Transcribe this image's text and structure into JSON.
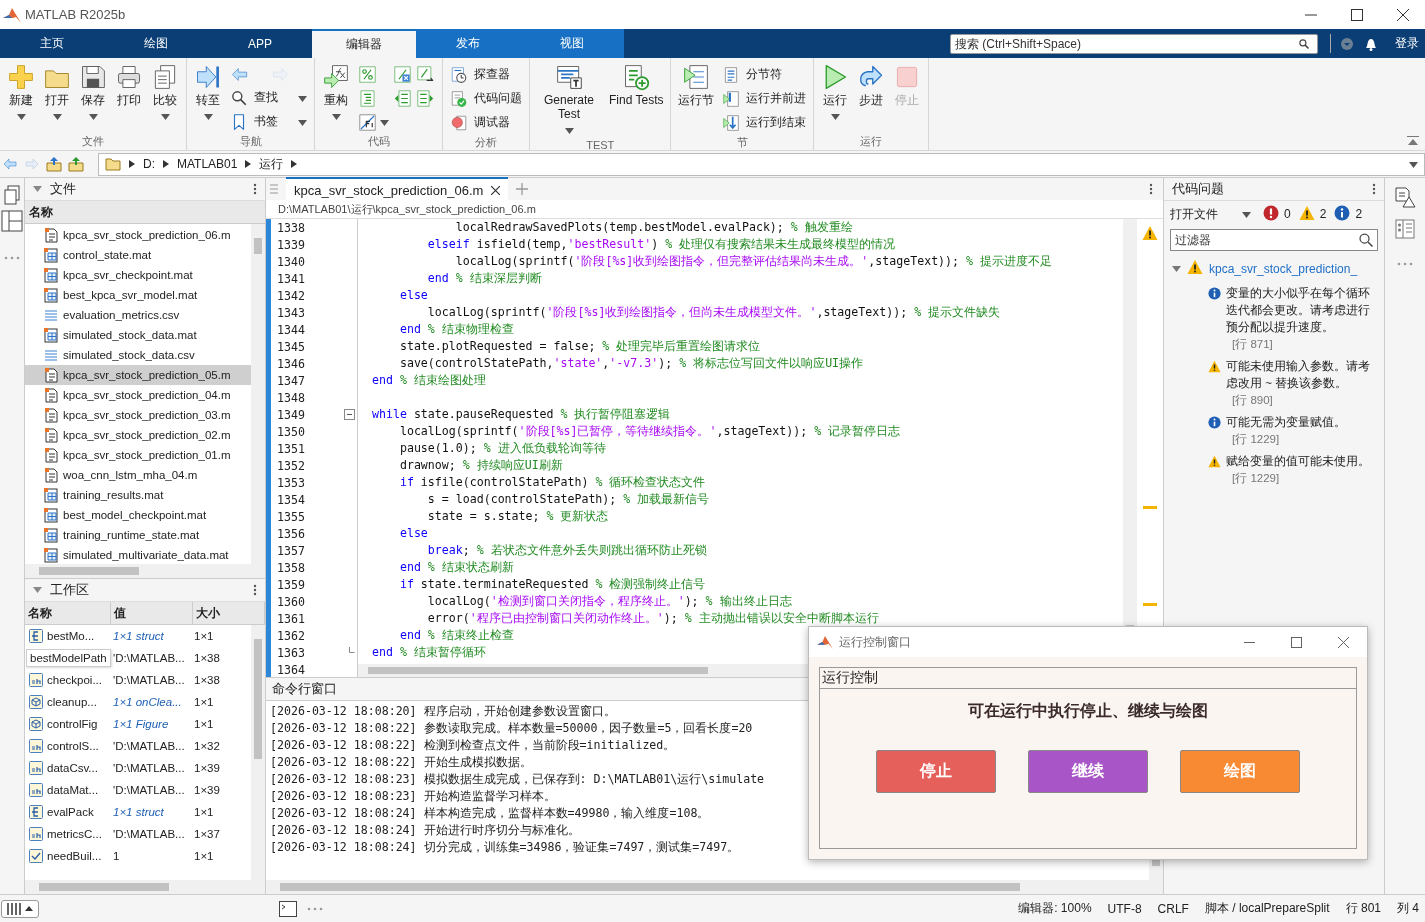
{
  "window": {
    "title": "MATLAB R2025b"
  },
  "tabs": [
    {
      "label": "主页",
      "selected": false,
      "contextual": false
    },
    {
      "label": "绘图",
      "selected": false,
      "contextual": false
    },
    {
      "label": "APP",
      "selected": false,
      "contextual": false
    },
    {
      "label": "编辑器",
      "selected": true,
      "contextual": true
    },
    {
      "label": "发布",
      "selected": false,
      "contextual": true
    },
    {
      "label": "视图",
      "selected": false,
      "contextual": true
    }
  ],
  "search": {
    "placeholder": "搜索 (Ctrl+Shift+Space)"
  },
  "login": "登录",
  "toolstrip": [
    {
      "label": "文件",
      "items": [
        {
          "kind": "large",
          "label": "新建",
          "menu": true,
          "disabled": false
        },
        {
          "kind": "large",
          "label": "打开",
          "menu": true,
          "disabled": false
        },
        {
          "kind": "large",
          "label": "保存",
          "menu": true,
          "disabled": false
        },
        {
          "kind": "large",
          "label": "打印",
          "menu": false,
          "disabled": false
        },
        {
          "kind": "large",
          "label": "比较",
          "menu": true,
          "disabled": false
        }
      ]
    },
    {
      "label": "导航",
      "items": [
        {
          "kind": "large",
          "label": "转至",
          "menu": true,
          "disabled": false
        },
        {
          "kind": "icon",
          "menu": false,
          "disabled": false
        },
        {
          "kind": "icon",
          "menu": false,
          "disabled": true
        },
        {
          "kind": "small",
          "label": "查找",
          "menu": true,
          "disabled": false
        },
        {
          "kind": "small",
          "label": "书签",
          "menu": true,
          "disabled": false
        }
      ]
    },
    {
      "label": "代码",
      "items": [
        {
          "kind": "large",
          "label": "重构",
          "menu": true,
          "disabled": false
        },
        {
          "kind": "icon",
          "menu": false,
          "disabled": false
        },
        {
          "kind": "icon",
          "menu": false,
          "disabled": false
        },
        {
          "kind": "icon",
          "menu": false,
          "disabled": false
        },
        {
          "kind": "icon",
          "menu": false,
          "disabled": false
        },
        {
          "kind": "icon",
          "menu": false,
          "disabled": false
        },
        {
          "kind": "icon",
          "menu": false,
          "disabled": false
        },
        {
          "kind": "icon",
          "menu": true,
          "disabled": false
        }
      ]
    },
    {
      "label": "分析",
      "items": [
        {
          "kind": "small",
          "label": "探查器",
          "menu": false,
          "disabled": false
        },
        {
          "kind": "small",
          "label": "代码问题",
          "menu": false,
          "disabled": false
        },
        {
          "kind": "small",
          "label": "调试器",
          "menu": false,
          "disabled": false
        }
      ]
    },
    {
      "label": "TEST",
      "items": [
        {
          "kind": "large",
          "label": "Generate Test",
          "menu": true,
          "disabled": false
        },
        {
          "kind": "large",
          "label": "Find Tests",
          "menu": false,
          "disabled": false
        }
      ]
    },
    {
      "label": "节",
      "items": [
        {
          "kind": "large",
          "label": "运行节",
          "menu": false,
          "disabled": false
        },
        {
          "kind": "small",
          "label": "分节符",
          "menu": false,
          "disabled": false
        },
        {
          "kind": "small",
          "label": "运行并前进",
          "menu": false,
          "disabled": false
        },
        {
          "kind": "small",
          "label": "运行到结束",
          "menu": false,
          "disabled": false
        }
      ]
    },
    {
      "label": "运行",
      "items": [
        {
          "kind": "large",
          "label": "运行",
          "menu": true,
          "disabled": false
        },
        {
          "kind": "large",
          "label": "步进",
          "menu": false,
          "disabled": false
        },
        {
          "kind": "large",
          "label": "停止",
          "menu": false,
          "disabled": true
        }
      ]
    }
  ],
  "address": [
    "D:",
    "MATLAB01",
    "运行"
  ],
  "files": {
    "title": "文件",
    "column": "名称",
    "items": [
      {
        "name": "kpca_svr_stock_prediction_06.m",
        "kind": "m",
        "selected": false
      },
      {
        "name": "control_state.mat",
        "kind": "mat",
        "selected": false
      },
      {
        "name": "kpca_svr_checkpoint.mat",
        "kind": "mat",
        "selected": false
      },
      {
        "name": "best_kpca_svr_model.mat",
        "kind": "mat",
        "selected": false
      },
      {
        "name": "evaluation_metrics.csv",
        "kind": "csv",
        "selected": false
      },
      {
        "name": "simulated_stock_data.mat",
        "kind": "mat",
        "selected": false
      },
      {
        "name": "simulated_stock_data.csv",
        "kind": "csv",
        "selected": false
      },
      {
        "name": "kpca_svr_stock_prediction_05.m",
        "kind": "m",
        "selected": true
      },
      {
        "name": "kpca_svr_stock_prediction_04.m",
        "kind": "m",
        "selected": false
      },
      {
        "name": "kpca_svr_stock_prediction_03.m",
        "kind": "m",
        "selected": false
      },
      {
        "name": "kpca_svr_stock_prediction_02.m",
        "kind": "m",
        "selected": false
      },
      {
        "name": "kpca_svr_stock_prediction_01.m",
        "kind": "m",
        "selected": false
      },
      {
        "name": "woa_cnn_lstm_mha_04.m",
        "kind": "m",
        "selected": false
      },
      {
        "name": "training_results.mat",
        "kind": "mat",
        "selected": false
      },
      {
        "name": "best_model_checkpoint.mat",
        "kind": "mat",
        "selected": false
      },
      {
        "name": "training_runtime_state.mat",
        "kind": "mat",
        "selected": false
      },
      {
        "name": "simulated_multivariate_data.mat",
        "kind": "mat",
        "selected": false
      }
    ]
  },
  "workspace": {
    "title": "工作区",
    "columns": [
      "名称",
      "值",
      "大小"
    ],
    "tooltip": "bestModelPath",
    "rows": [
      {
        "kind": "struct",
        "name": "bestMo...",
        "value": "1×1 struct",
        "size": "1×1"
      },
      {
        "value": "'D:\\MATLAB...",
        "size": "1×38"
      },
      {
        "kind": "char",
        "name": "checkpoi...",
        "value": "'D:\\MATLAB...",
        "size": "1×38"
      },
      {
        "kind": "object",
        "name": "cleanup...",
        "value": "1×1 onClea...",
        "size": "1×1"
      },
      {
        "kind": "object",
        "name": "controlFig",
        "value": "1×1 Figure",
        "size": "1×1"
      },
      {
        "kind": "char",
        "name": "controlS...",
        "value": "'D:\\MATLAB...",
        "size": "1×32"
      },
      {
        "kind": "char",
        "name": "dataCsv...",
        "value": "'D:\\MATLAB...",
        "size": "1×39"
      },
      {
        "kind": "char",
        "name": "dataMat...",
        "value": "'D:\\MATLAB...",
        "size": "1×39"
      },
      {
        "kind": "struct",
        "name": "evalPack",
        "value": "1×1 struct",
        "size": "1×1"
      },
      {
        "kind": "char",
        "name": "metricsC...",
        "value": "'D:\\MATLAB...",
        "size": "1×37"
      },
      {
        "kind": "logical",
        "name": "needBuil...",
        "value": "1",
        "size": "1×1"
      }
    ]
  },
  "editor": {
    "tab": "kpca_svr_stock_prediction_06.m",
    "path": "D:\\MATLAB01\\运行\\kpca_svr_stock_prediction_06.m",
    "lines": [
      {
        "num": "1338",
        "fold_start": false,
        "fold_end": false,
        "tokens": [
          {
            "kind": "plain",
            "text": "            localRedrawSavedPlots(temp.bestModel.evalPack); "
          },
          {
            "kind": "cmt",
            "text": "% 触发重绘"
          }
        ]
      },
      {
        "num": "1339",
        "fold_start": false,
        "fold_end": false,
        "tokens": [
          {
            "kind": "kw",
            "text": "        elseif"
          },
          {
            "kind": "plain",
            "text": " isfield(temp,"
          },
          {
            "kind": "str",
            "text": "'bestResult'"
          },
          {
            "kind": "plain",
            "text": ") "
          },
          {
            "kind": "cmt",
            "text": "% 处理仅有搜索结果未生成最终模型的情况"
          }
        ]
      },
      {
        "num": "1340",
        "fold_start": false,
        "fold_end": false,
        "tokens": [
          {
            "kind": "plain",
            "text": "            localLog(sprintf("
          },
          {
            "kind": "str",
            "text": "'阶段[%s]收到绘图指令，但完整评估结果尚未生成。'"
          },
          {
            "kind": "plain",
            "text": ",stageText)); "
          },
          {
            "kind": "cmt",
            "text": "% 提示进度不足"
          }
        ]
      },
      {
        "num": "1341",
        "fold_start": false,
        "fold_end": false,
        "tokens": [
          {
            "kind": "kw",
            "text": "        end "
          },
          {
            "kind": "cmt",
            "text": "% 结束深层判断"
          }
        ]
      },
      {
        "num": "1342",
        "fold_start": false,
        "fold_end": false,
        "tokens": [
          {
            "kind": "kw",
            "text": "    else"
          }
        ]
      },
      {
        "num": "1343",
        "fold_start": false,
        "fold_end": false,
        "tokens": [
          {
            "kind": "plain",
            "text": "        localLog(sprintf("
          },
          {
            "kind": "str",
            "text": "'阶段[%s]收到绘图指令，但尚未生成模型文件。'"
          },
          {
            "kind": "plain",
            "text": ",stageText)); "
          },
          {
            "kind": "cmt",
            "text": "% 提示文件缺失"
          }
        ]
      },
      {
        "num": "1344",
        "fold_start": false,
        "fold_end": false,
        "tokens": [
          {
            "kind": "kw",
            "text": "    end "
          },
          {
            "kind": "cmt",
            "text": "% 结束物理检查"
          }
        ]
      },
      {
        "num": "1345",
        "fold_start": false,
        "fold_end": false,
        "tokens": [
          {
            "kind": "plain",
            "text": "    state.plotRequested = false; "
          },
          {
            "kind": "cmt",
            "text": "% 处理完毕后重置绘图请求位"
          }
        ]
      },
      {
        "num": "1346",
        "fold_start": false,
        "fold_end": false,
        "tokens": [
          {
            "kind": "plain",
            "text": "    save(controlStatePath,"
          },
          {
            "kind": "str",
            "text": "'state'"
          },
          {
            "kind": "plain",
            "text": ","
          },
          {
            "kind": "str",
            "text": "'-v7.3'"
          },
          {
            "kind": "plain",
            "text": "); "
          },
          {
            "kind": "cmt",
            "text": "% 将标志位写回文件以响应UI操作"
          }
        ]
      },
      {
        "num": "1347",
        "fold_start": false,
        "fold_end": false,
        "tokens": [
          {
            "kind": "kw",
            "text": "end "
          },
          {
            "kind": "cmt",
            "text": "% 结束绘图处理"
          }
        ]
      },
      {
        "num": "1348",
        "fold_start": false,
        "fold_end": false
      },
      {
        "num": "1349",
        "fold_start": true,
        "fold_end": false,
        "tokens": [
          {
            "kind": "kw",
            "text": "while"
          },
          {
            "kind": "plain",
            "text": " state.pauseRequested "
          },
          {
            "kind": "cmt",
            "text": "% 执行暂停阻塞逻辑"
          }
        ]
      },
      {
        "num": "1350",
        "fold_start": false,
        "fold_end": false,
        "tokens": [
          {
            "kind": "plain",
            "text": "    localLog(sprintf("
          },
          {
            "kind": "str",
            "text": "'阶段[%s]已暂停，等待继续指令。'"
          },
          {
            "kind": "plain",
            "text": ",stageText)); "
          },
          {
            "kind": "cmt",
            "text": "% 记录暂停日志"
          }
        ]
      },
      {
        "num": "1351",
        "fold_start": false,
        "fold_end": false,
        "tokens": [
          {
            "kind": "plain",
            "text": "    pause(1.0); "
          },
          {
            "kind": "cmt",
            "text": "% 进入低负载轮询等待"
          }
        ]
      },
      {
        "num": "1352",
        "fold_start": false,
        "fold_end": false,
        "tokens": [
          {
            "kind": "plain",
            "text": "    drawnow; "
          },
          {
            "kind": "cmt",
            "text": "% 持续响应UI刷新"
          }
        ]
      },
      {
        "num": "1353",
        "fold_start": false,
        "fold_end": false,
        "tokens": [
          {
            "kind": "kw",
            "text": "    if"
          },
          {
            "kind": "plain",
            "text": " isfile(controlStatePath) "
          },
          {
            "kind": "cmt",
            "text": "% 循环检查状态文件"
          }
        ]
      },
      {
        "num": "1354",
        "fold_start": false,
        "fold_end": false,
        "tokens": [
          {
            "kind": "plain",
            "text": "        s = load(controlStatePath); "
          },
          {
            "kind": "cmt",
            "text": "% 加载最新信号"
          }
        ]
      },
      {
        "num": "1355",
        "fold_start": false,
        "fold_end": false,
        "tokens": [
          {
            "kind": "plain",
            "text": "        state = s.state; "
          },
          {
            "kind": "cmt",
            "text": "% 更新状态"
          }
        ]
      },
      {
        "num": "1356",
        "fold_start": false,
        "fold_end": false,
        "tokens": [
          {
            "kind": "kw",
            "text": "    else"
          }
        ]
      },
      {
        "num": "1357",
        "fold_start": false,
        "fold_end": false,
        "tokens": [
          {
            "kind": "kw",
            "text": "        break"
          },
          {
            "kind": "plain",
            "text": "; "
          },
          {
            "kind": "cmt",
            "text": "% 若状态文件意外丢失则跳出循环防止死锁"
          }
        ]
      },
      {
        "num": "1358",
        "fold_start": false,
        "fold_end": false,
        "tokens": [
          {
            "kind": "kw",
            "text": "    end "
          },
          {
            "kind": "cmt",
            "text": "% 结束状态刷新"
          }
        ]
      },
      {
        "num": "1359",
        "fold_start": false,
        "fold_end": false,
        "tokens": [
          {
            "kind": "kw",
            "text": "    if"
          },
          {
            "kind": "plain",
            "text": " state.terminateRequested "
          },
          {
            "kind": "cmt",
            "text": "% 检测强制终止信号"
          }
        ]
      },
      {
        "num": "1360",
        "fold_start": false,
        "fold_end": false,
        "tokens": [
          {
            "kind": "plain",
            "text": "        localLog("
          },
          {
            "kind": "str",
            "text": "'检测到窗口关闭指令，程序终止。'"
          },
          {
            "kind": "plain",
            "text": "); "
          },
          {
            "kind": "cmt",
            "text": "% 输出终止日志"
          }
        ]
      },
      {
        "num": "1361",
        "fold_start": false,
        "fold_end": false,
        "tokens": [
          {
            "kind": "plain",
            "text": "        error("
          },
          {
            "kind": "str",
            "text": "'程序已由控制窗口关闭动作终止。'"
          },
          {
            "kind": "plain",
            "text": "); "
          },
          {
            "kind": "cmt",
            "text": "% 主动抛出错误以安全中断脚本运行"
          }
        ]
      },
      {
        "num": "1362",
        "fold_start": false,
        "fold_end": false,
        "tokens": [
          {
            "kind": "kw",
            "text": "    end "
          },
          {
            "kind": "cmt",
            "text": "% 结束终止检查"
          }
        ]
      },
      {
        "num": "1363",
        "fold_start": false,
        "fold_end": true,
        "tokens": [
          {
            "kind": "kw",
            "text": "end "
          },
          {
            "kind": "cmt",
            "text": "% 结束暂停循环"
          }
        ]
      },
      {
        "num": "1364",
        "fold_start": false,
        "fold_end": false
      }
    ]
  },
  "command_window": {
    "title": "命令行窗口",
    "lines": [
      "[2026-03-12 18:08:20] 程序启动，开始创建参数设置窗口。",
      "[2026-03-12 18:08:22] 参数读取完成。样本数量=50000，因子数量=5，回看长度=20",
      "[2026-03-12 18:08:22] 检测到检查点文件，当前阶段=initialized。",
      "[2026-03-12 18:08:22] 开始生成模拟数据。",
      "[2026-03-12 18:08:23] 模拟数据生成完成，已保存到: D:\\MATLAB01\\运行\\simulate",
      "[2026-03-12 18:08:23] 开始构造监督学习样本。",
      "[2026-03-12 18:08:24] 样本构造完成，监督样本数=49980，输入维度=108。",
      "[2026-03-12 18:08:24] 开始进行时序切分与标准化。",
      "[2026-03-12 18:08:24] 切分完成，训练集=34986，验证集=7497，测试集=7497。"
    ]
  },
  "code_issues": {
    "title": "代码问题",
    "scope": "打开文件",
    "counts": [
      {
        "kind": "error",
        "count": "0"
      },
      {
        "kind": "warning",
        "count": "2"
      },
      {
        "kind": "info",
        "count": "2"
      }
    ],
    "filter_placeholder": "过滤器",
    "file": {
      "name": "kpca_svr_stock_prediction_",
      "kind": "warning",
      "expanded": true,
      "children": [
        {
          "kind": "info",
          "text": "变量的大小似乎在每个循环迭代都会更改。请考虑进行预分配以提升速度。",
          "ref": "[行 871]"
        },
        {
          "kind": "warning",
          "text": "可能未使用输入参数。请考虑改用 ~ 替换该参数。",
          "ref": "[行 890]"
        },
        {
          "kind": "info",
          "text": "可能无需为变量赋值。",
          "ref": "[行 1229]"
        },
        {
          "kind": "warning",
          "text": "赋给变量的值可能未使用。",
          "ref": "[行 1229]"
        }
      ]
    }
  },
  "dialog": {
    "title": "运行控制窗口",
    "panel_title": "运行控制",
    "heading": "可在运行中执行停止、继续与绘图",
    "buttons": [
      {
        "label": "停止",
        "color": "#e5605a"
      },
      {
        "label": "继续",
        "color": "#a855c8"
      },
      {
        "label": "绘图",
        "color": "#f98a34"
      }
    ]
  },
  "status_bar": [
    "编辑器: 100%",
    "UTF-8",
    "CRLF",
    "脚本 / localPrepareSplit",
    "行 801",
    "列 4"
  ]
}
